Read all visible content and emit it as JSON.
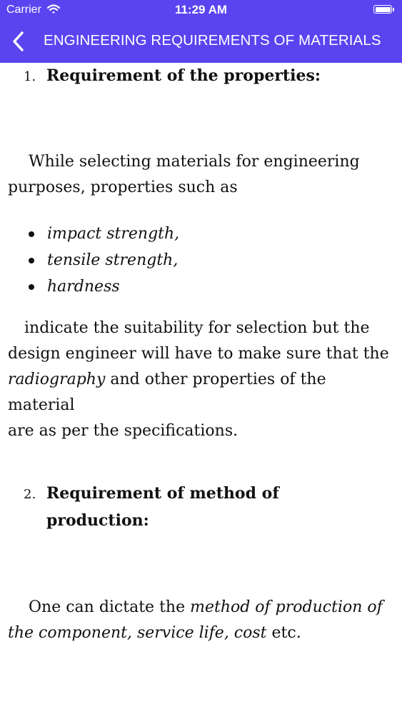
{
  "status_bar": {
    "carrier": "Carrier",
    "time": "11:29 AM"
  },
  "nav": {
    "title": "ENGINEERING REQUIREMENTS OF MATERIALS"
  },
  "section1": {
    "number": "1.",
    "title": "Requirement of the properties:",
    "intro_line1": "While selecting materials for engineering",
    "intro_line2": "purposes, properties such as",
    "bullets": [
      "impact strength,",
      "tensile strength,",
      "hardness"
    ],
    "para_l1": "indicate the suitability for selection but the",
    "para_l2": "design engineer will have to make sure that the",
    "para_l3_em": "radiography",
    "para_l3_rest": " and other properties of the material",
    "para_l4": "are as per the specifications."
  },
  "section2": {
    "number": "2.",
    "title_line1": "Requirement of method of",
    "title_line2": "production:",
    "l1_plain": "One can dictate the ",
    "l1_em": "method of production of",
    "l2_em": "the component, service life, cost",
    "l2_rest": " etc."
  }
}
